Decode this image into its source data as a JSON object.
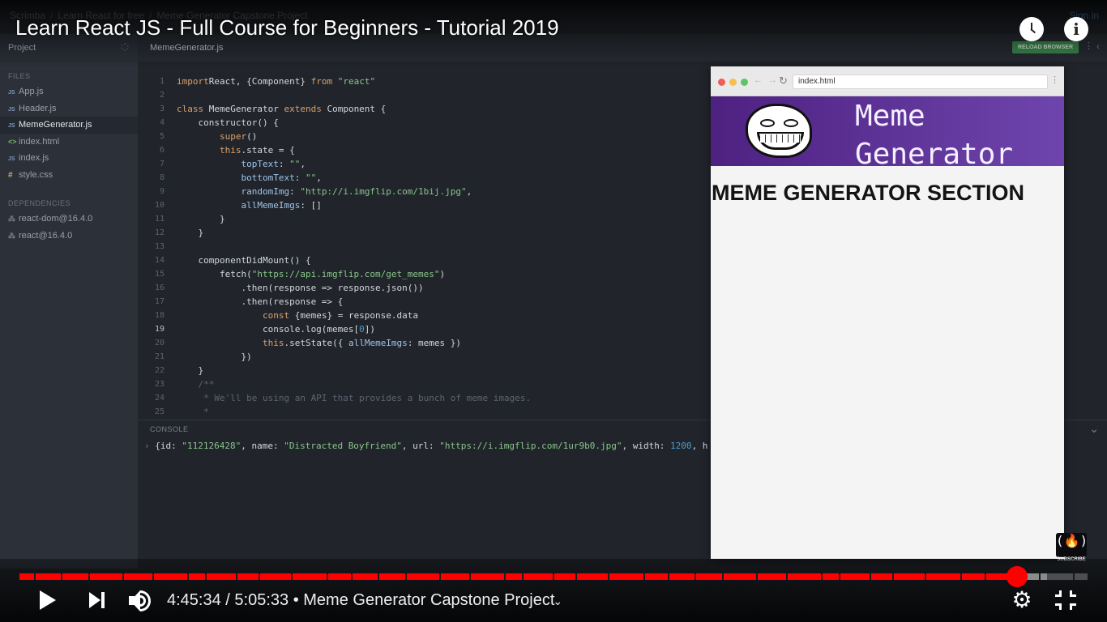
{
  "video": {
    "title": "Learn React JS - Full Course for Beginners - Tutorial 2019",
    "current_time": "4:45:34",
    "duration": "5:05:33",
    "separator": " / ",
    "bullet": " • ",
    "chapter": "Meme Generator Capstone Project",
    "progress_fraction": 0.934,
    "buffered_fraction": 0.962,
    "accent_color": "#ff0000"
  },
  "scrimba": {
    "crumbs": [
      "Scrimba",
      "Learn React for free",
      "Meme Generator Capstone Project"
    ],
    "crumb_sep": "/",
    "sign_in": "Sign in"
  },
  "sidebar": {
    "header": "Project",
    "files_label": "FILES",
    "files": [
      {
        "icon": "JS",
        "name": "App.js"
      },
      {
        "icon": "JS",
        "name": "Header.js"
      },
      {
        "icon": "JS",
        "name": "MemeGenerator.js",
        "active": true
      },
      {
        "icon": "<>",
        "name": "index.html"
      },
      {
        "icon": "JS",
        "name": "index.js"
      },
      {
        "icon": "#",
        "name": "style.css"
      }
    ],
    "deps_label": "DEPENDENCIES",
    "deps": [
      {
        "icon": "⁂",
        "name": "react-dom@16.4.0"
      },
      {
        "icon": "⁂",
        "name": "react@16.4.0"
      }
    ]
  },
  "editor": {
    "tab": "MemeGenerator.js",
    "reload_label": "RELOAD BROWSER",
    "highlight_line": 19,
    "code": [
      [
        [
          "kw",
          "import"
        ],
        [
          "",
          "React, {Component} "
        ],
        [
          "kw",
          "from"
        ],
        [
          "str",
          " \"react\""
        ]
      ],
      [],
      [
        [
          "kw",
          "class"
        ],
        [
          "",
          " MemeGenerator "
        ],
        [
          "kw",
          "extends"
        ],
        [
          "",
          " Component {"
        ]
      ],
      [
        [
          "",
          "    constructor() {"
        ]
      ],
      [
        [
          "",
          "        "
        ],
        [
          "kw",
          "super"
        ],
        [
          "",
          "()"
        ]
      ],
      [
        [
          "",
          "        "
        ],
        [
          "kw",
          "this"
        ],
        [
          "",
          ".state = {"
        ]
      ],
      [
        [
          "",
          "            "
        ],
        [
          "prop",
          "topText"
        ],
        [
          "",
          ": "
        ],
        [
          "str",
          "\"\""
        ],
        [
          "",
          ","
        ]
      ],
      [
        [
          "",
          "            "
        ],
        [
          "prop",
          "bottomText"
        ],
        [
          "",
          ": "
        ],
        [
          "str",
          "\"\""
        ],
        [
          "",
          ","
        ]
      ],
      [
        [
          "",
          "            "
        ],
        [
          "prop",
          "randomImg"
        ],
        [
          "",
          ": "
        ],
        [
          "str",
          "\"http://i.imgflip.com/1bij.jpg\""
        ],
        [
          "",
          ","
        ]
      ],
      [
        [
          "",
          "            "
        ],
        [
          "prop",
          "allMemeImgs"
        ],
        [
          "",
          ": []"
        ]
      ],
      [
        [
          "",
          "        }"
        ]
      ],
      [
        [
          "",
          "    }"
        ]
      ],
      [],
      [
        [
          "",
          "    componentDidMount() {"
        ]
      ],
      [
        [
          "",
          "        fetch("
        ],
        [
          "str",
          "\"https://api.imgflip.com/get_memes\""
        ],
        [
          "",
          ")"
        ]
      ],
      [
        [
          "",
          "            .then(response => response.json())"
        ]
      ],
      [
        [
          "",
          "            .then(response => {"
        ]
      ],
      [
        [
          "",
          "                "
        ],
        [
          "kw",
          "const"
        ],
        [
          "",
          " {memes} = response.data"
        ]
      ],
      [
        [
          "",
          "                console.log(memes["
        ],
        [
          "num",
          "0"
        ],
        [
          "",
          "])"
        ]
      ],
      [
        [
          "",
          "                "
        ],
        [
          "kw",
          "this"
        ],
        [
          "",
          ".setState({ "
        ],
        [
          "prop",
          "allMemeImgs"
        ],
        [
          "",
          ": memes })"
        ]
      ],
      [
        [
          "",
          "            })"
        ]
      ],
      [
        [
          "",
          "    }"
        ]
      ],
      [
        [
          "cm",
          "    /**"
        ]
      ],
      [
        [
          "cm",
          "     * We'll be using an API that provides a bunch of meme images."
        ]
      ],
      [
        [
          "cm",
          "     *"
        ]
      ]
    ]
  },
  "console": {
    "label": "CONSOLE",
    "line": [
      [
        "",
        "{id: "
      ],
      [
        "str",
        "\"112126428\""
      ],
      [
        "",
        ", name: "
      ],
      [
        "str",
        "\"Distracted Boyfriend\""
      ],
      [
        "",
        ", url: "
      ],
      [
        "str",
        "\"https://i.imgflip.com/1ur9b0.jpg\""
      ],
      [
        "",
        ", width: "
      ],
      [
        "num",
        "1200"
      ],
      [
        "",
        ", h"
      ]
    ]
  },
  "browser": {
    "address": "index.html",
    "nav_arrows": "← →",
    "reload_glyph": "↻",
    "menu_glyph": "⋮",
    "logo_text": "Meme\nGenerator",
    "section_heading": "MEME GENERATOR SECTION"
  },
  "badge": {
    "glyph": "(🔥)",
    "subscribe": "SUBSCRIBE"
  },
  "controls": {
    "settings_glyph": "⚙",
    "chevron_glyph": "⌄"
  }
}
